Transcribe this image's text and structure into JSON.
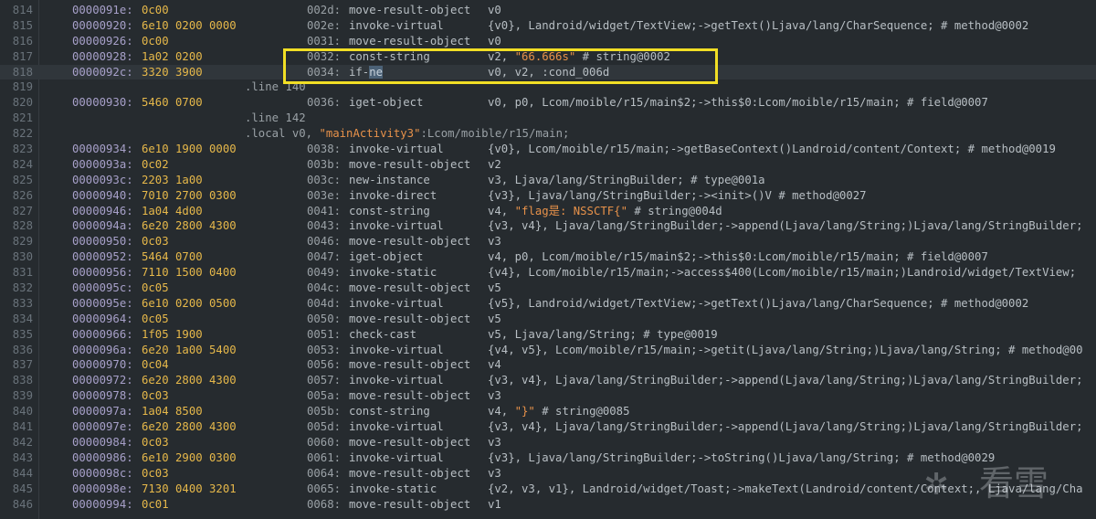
{
  "editor": {
    "lines": [
      {
        "ln": "814",
        "addr": "0000091e:",
        "bytes": "0c00",
        "off": "002d:",
        "op": "move-result-object",
        "args": [
          {
            "t": "v0"
          }
        ]
      },
      {
        "ln": "815",
        "addr": "00000920:",
        "bytes": "6e10 0200 0000",
        "off": "002e:",
        "op": "invoke-virtual",
        "args": [
          {
            "t": "{v0}, Landroid/widget/TextView;->getText()Ljava/lang/CharSequence; # method@0002"
          }
        ]
      },
      {
        "ln": "816",
        "addr": "00000926:",
        "bytes": "0c00",
        "off": "0031:",
        "op": "move-result-object",
        "args": [
          {
            "t": "v0"
          }
        ]
      },
      {
        "ln": "817",
        "addr": "00000928:",
        "bytes": "1a02 0200",
        "off": "0032:",
        "op": "const-string",
        "args": [
          {
            "t": "v2, "
          },
          {
            "t": "\"66.666s\"",
            "s": "str"
          },
          {
            "t": " # string@0002"
          }
        ]
      },
      {
        "ln": "818",
        "addr": "0000092c:",
        "bytes": "3320 3900",
        "off": "0034:",
        "op": "if-ne",
        "op_sel": "ne",
        "args": [
          {
            "t": "v0, v2, :cond_006d"
          }
        ],
        "current": true
      },
      {
        "ln": "819",
        "directive": ".line 140"
      },
      {
        "ln": "820",
        "addr": "00000930:",
        "bytes": "5460 0700",
        "off": "0036:",
        "op": "iget-object",
        "args": [
          {
            "t": "v0, p0, Lcom/moible/r15/main$2;->this$0:Lcom/moible/r15/main; # field@0007"
          }
        ]
      },
      {
        "ln": "821",
        "directive": ".line 142"
      },
      {
        "ln": "822",
        "directive": ".local v0, ",
        "directive_str": "\"mainActivity3\"",
        "directive_rest": ":Lcom/moible/r15/main;"
      },
      {
        "ln": "823",
        "addr": "00000934:",
        "bytes": "6e10 1900 0000",
        "off": "0038:",
        "op": "invoke-virtual",
        "args": [
          {
            "t": "{v0}, Lcom/moible/r15/main;->getBaseContext()Landroid/content/Context; # method@0019"
          }
        ]
      },
      {
        "ln": "824",
        "addr": "0000093a:",
        "bytes": "0c02",
        "off": "003b:",
        "op": "move-result-object",
        "args": [
          {
            "t": "v2"
          }
        ]
      },
      {
        "ln": "825",
        "addr": "0000093c:",
        "bytes": "2203 1a00",
        "off": "003c:",
        "op": "new-instance",
        "args": [
          {
            "t": "v3, Ljava/lang/StringBuilder; # type@001a"
          }
        ]
      },
      {
        "ln": "826",
        "addr": "00000940:",
        "bytes": "7010 2700 0300",
        "off": "003e:",
        "op": "invoke-direct",
        "args": [
          {
            "t": "{v3}, Ljava/lang/StringBuilder;-><init>()V # method@0027"
          }
        ]
      },
      {
        "ln": "827",
        "addr": "00000946:",
        "bytes": "1a04 4d00",
        "off": "0041:",
        "op": "const-string",
        "args": [
          {
            "t": "v4, "
          },
          {
            "t": "\"flag是: NSSCTF{\"",
            "s": "str"
          },
          {
            "t": " # string@004d"
          }
        ]
      },
      {
        "ln": "828",
        "addr": "0000094a:",
        "bytes": "6e20 2800 4300",
        "off": "0043:",
        "op": "invoke-virtual",
        "args": [
          {
            "t": "{v3, v4}, Ljava/lang/StringBuilder;->append(Ljava/lang/String;)Ljava/lang/StringBuilder;"
          }
        ]
      },
      {
        "ln": "829",
        "addr": "00000950:",
        "bytes": "0c03",
        "off": "0046:",
        "op": "move-result-object",
        "args": [
          {
            "t": "v3"
          }
        ]
      },
      {
        "ln": "830",
        "addr": "00000952:",
        "bytes": "5464 0700",
        "off": "0047:",
        "op": "iget-object",
        "args": [
          {
            "t": "v4, p0, Lcom/moible/r15/main$2;->this$0:Lcom/moible/r15/main; # field@0007"
          }
        ]
      },
      {
        "ln": "831",
        "addr": "00000956:",
        "bytes": "7110 1500 0400",
        "off": "0049:",
        "op": "invoke-static",
        "args": [
          {
            "t": "{v4}, Lcom/moible/r15/main;->access$400(Lcom/moible/r15/main;)Landroid/widget/TextView;"
          }
        ]
      },
      {
        "ln": "832",
        "addr": "0000095c:",
        "bytes": "0c05",
        "off": "004c:",
        "op": "move-result-object",
        "args": [
          {
            "t": "v5"
          }
        ]
      },
      {
        "ln": "833",
        "addr": "0000095e:",
        "bytes": "6e10 0200 0500",
        "off": "004d:",
        "op": "invoke-virtual",
        "args": [
          {
            "t": "{v5}, Landroid/widget/TextView;->getText()Ljava/lang/CharSequence; # method@0002"
          }
        ]
      },
      {
        "ln": "834",
        "addr": "00000964:",
        "bytes": "0c05",
        "off": "0050:",
        "op": "move-result-object",
        "args": [
          {
            "t": "v5"
          }
        ]
      },
      {
        "ln": "835",
        "addr": "00000966:",
        "bytes": "1f05 1900",
        "off": "0051:",
        "op": "check-cast",
        "args": [
          {
            "t": "v5, Ljava/lang/String; # type@0019"
          }
        ]
      },
      {
        "ln": "836",
        "addr": "0000096a:",
        "bytes": "6e20 1a00 5400",
        "off": "0053:",
        "op": "invoke-virtual",
        "args": [
          {
            "t": "{v4, v5}, Lcom/moible/r15/main;->getit(Ljava/lang/String;)Ljava/lang/String; # method@00"
          }
        ]
      },
      {
        "ln": "837",
        "addr": "00000970:",
        "bytes": "0c04",
        "off": "0056:",
        "op": "move-result-object",
        "args": [
          {
            "t": "v4"
          }
        ]
      },
      {
        "ln": "838",
        "addr": "00000972:",
        "bytes": "6e20 2800 4300",
        "off": "0057:",
        "op": "invoke-virtual",
        "args": [
          {
            "t": "{v3, v4}, Ljava/lang/StringBuilder;->append(Ljava/lang/String;)Ljava/lang/StringBuilder;"
          }
        ]
      },
      {
        "ln": "839",
        "addr": "00000978:",
        "bytes": "0c03",
        "off": "005a:",
        "op": "move-result-object",
        "args": [
          {
            "t": "v3"
          }
        ]
      },
      {
        "ln": "840",
        "addr": "0000097a:",
        "bytes": "1a04 8500",
        "off": "005b:",
        "op": "const-string",
        "args": [
          {
            "t": "v4, "
          },
          {
            "t": "\"}\"",
            "s": "str"
          },
          {
            "t": " # string@0085"
          }
        ]
      },
      {
        "ln": "841",
        "addr": "0000097e:",
        "bytes": "6e20 2800 4300",
        "off": "005d:",
        "op": "invoke-virtual",
        "args": [
          {
            "t": "{v3, v4}, Ljava/lang/StringBuilder;->append(Ljava/lang/String;)Ljava/lang/StringBuilder;"
          }
        ]
      },
      {
        "ln": "842",
        "addr": "00000984:",
        "bytes": "0c03",
        "off": "0060:",
        "op": "move-result-object",
        "args": [
          {
            "t": "v3"
          }
        ]
      },
      {
        "ln": "843",
        "addr": "00000986:",
        "bytes": "6e10 2900 0300",
        "off": "0061:",
        "op": "invoke-virtual",
        "args": [
          {
            "t": "{v3}, Ljava/lang/StringBuilder;->toString()Ljava/lang/String; # method@0029"
          }
        ]
      },
      {
        "ln": "844",
        "addr": "0000098c:",
        "bytes": "0c03",
        "off": "0064:",
        "op": "move-result-object",
        "args": [
          {
            "t": "v3"
          }
        ]
      },
      {
        "ln": "845",
        "addr": "0000098e:",
        "bytes": "7130 0400 3201",
        "off": "0065:",
        "op": "invoke-static",
        "args": [
          {
            "t": "{v2, v3, v1}, Landroid/widget/Toast;->makeText(Landroid/content/Context;, Ljava/lang/Cha"
          }
        ]
      },
      {
        "ln": "846",
        "addr": "00000994:",
        "bytes": "0c01",
        "off": "0068:",
        "op": "move-result-object",
        "args": [
          {
            "t": "v1"
          }
        ]
      }
    ]
  },
  "watermark": {
    "logo_glyph": "✲",
    "text": "看雪"
  },
  "colors": {
    "background": "#262b2f",
    "address": "#a7a0c9",
    "bytes": "#e6b84a",
    "string": "#e8924a",
    "highlight_box": "#f1de25"
  }
}
